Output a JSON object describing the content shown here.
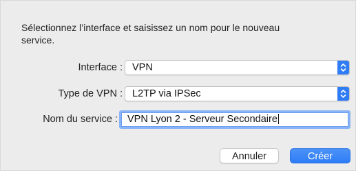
{
  "dialog": {
    "prompt": "Sélectionnez l’interface et saisissez un nom pour le nouveau service.",
    "interface": {
      "label": "Interface :",
      "value": "VPN"
    },
    "vpn_type": {
      "label": "Type de VPN :",
      "value": "L2TP via IPSec"
    },
    "service_name": {
      "label": "Nom du service :",
      "value": "VPN Lyon 2 - Serveur Secondaire"
    },
    "buttons": {
      "cancel": "Annuler",
      "create": "Créer"
    }
  },
  "colors": {
    "accent": "#2f7cf6",
    "background": "#ececec"
  },
  "icons": {
    "popup_stepper": "chevron-up-down-icon"
  }
}
